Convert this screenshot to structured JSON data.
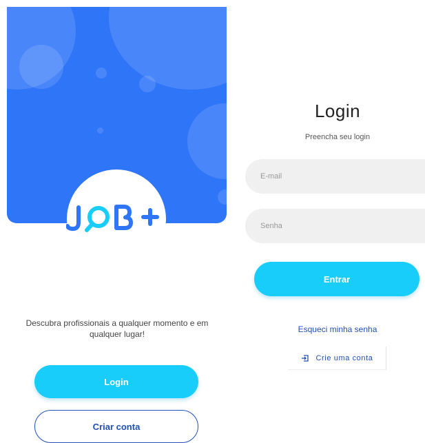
{
  "welcome": {
    "logo_text": "JOB+",
    "tagline": "Descubra profissionais a qualquer momento e em qualquer lugar!",
    "login_button": "Login",
    "create_account_button": "Criar conta"
  },
  "login": {
    "title": "Login",
    "subtitle": "Preencha seu login",
    "email_placeholder": "E-mail",
    "password_placeholder": "Senha",
    "enter_button": "Entrar",
    "forgot_password": "Esqueci minha senha",
    "create_account": "Crie uma conta",
    "create_account_icon": "sign-in-icon"
  },
  "colors": {
    "primary_blue": "#2f75f8",
    "accent_cyan": "#18cdfa",
    "dark_blue": "#1f4fb7"
  }
}
